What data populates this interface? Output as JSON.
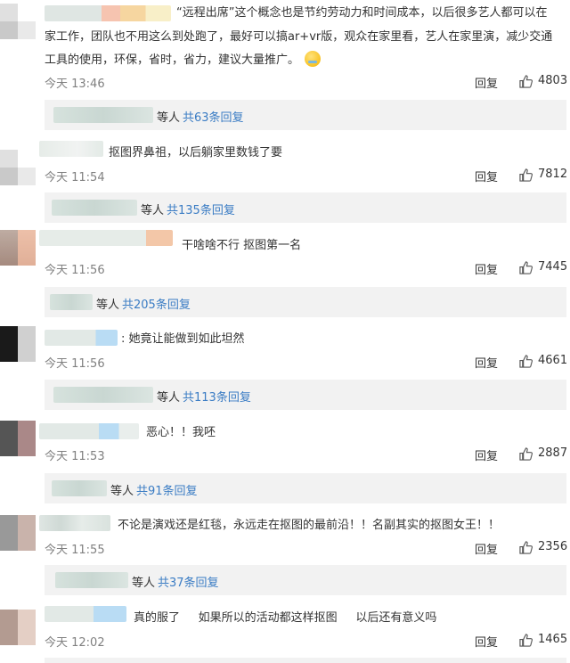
{
  "colors": {
    "link": "#3a7cc4",
    "meta": "#808080",
    "subbar_bg": "#f2f2f2"
  },
  "reply_label": "回复",
  "comments": [
    {
      "lines": [
        "“远程出席”这个概念也是节约劳动力和时间成本，以后很多艺人都可以在",
        "家工作，团队也不用这么到处跑了，最好可以搞ar+vr版，观众在家里看，艺人在家里演，减少交通",
        "工具的使用，环保，省时，省力，建议大量推广。"
      ],
      "time": "今天 13:46",
      "likes": "4803",
      "sub_etc": "等人",
      "sub_link": "共63条回复"
    },
    {
      "lines": [
        "抠图界鼻祖，以后躺家里数钱了要"
      ],
      "time": "今天 11:54",
      "likes": "7812",
      "sub_etc": "等人",
      "sub_link": "共135条回复"
    },
    {
      "lines": [
        "干啥啥不行 抠图第一名"
      ],
      "time": "今天 11:56",
      "likes": "7445",
      "sub_etc": "等人",
      "sub_link": "共205条回复"
    },
    {
      "lines": [
        ": 她竟让能做到如此坦然"
      ],
      "time": "今天 11:56",
      "likes": "4661",
      "sub_etc": "等人",
      "sub_link": "共113条回复"
    },
    {
      "lines": [
        "恶心！！我呸"
      ],
      "time": "今天 11:53",
      "likes": "2887",
      "sub_etc": "等人",
      "sub_link": "共91条回复"
    },
    {
      "lines": [
        "不论是演戏还是红毯，永远走在抠图的最前沿！！名副其实的抠图女王！！"
      ],
      "time": "今天 11:55",
      "likes": "2356",
      "sub_etc": "等人",
      "sub_link": "共37条回复"
    },
    {
      "lines": [
        "真的服了     如果所以的活动都这样抠图     以后还有意义吗"
      ],
      "time": "今天 12:02",
      "likes": "1465"
    }
  ]
}
